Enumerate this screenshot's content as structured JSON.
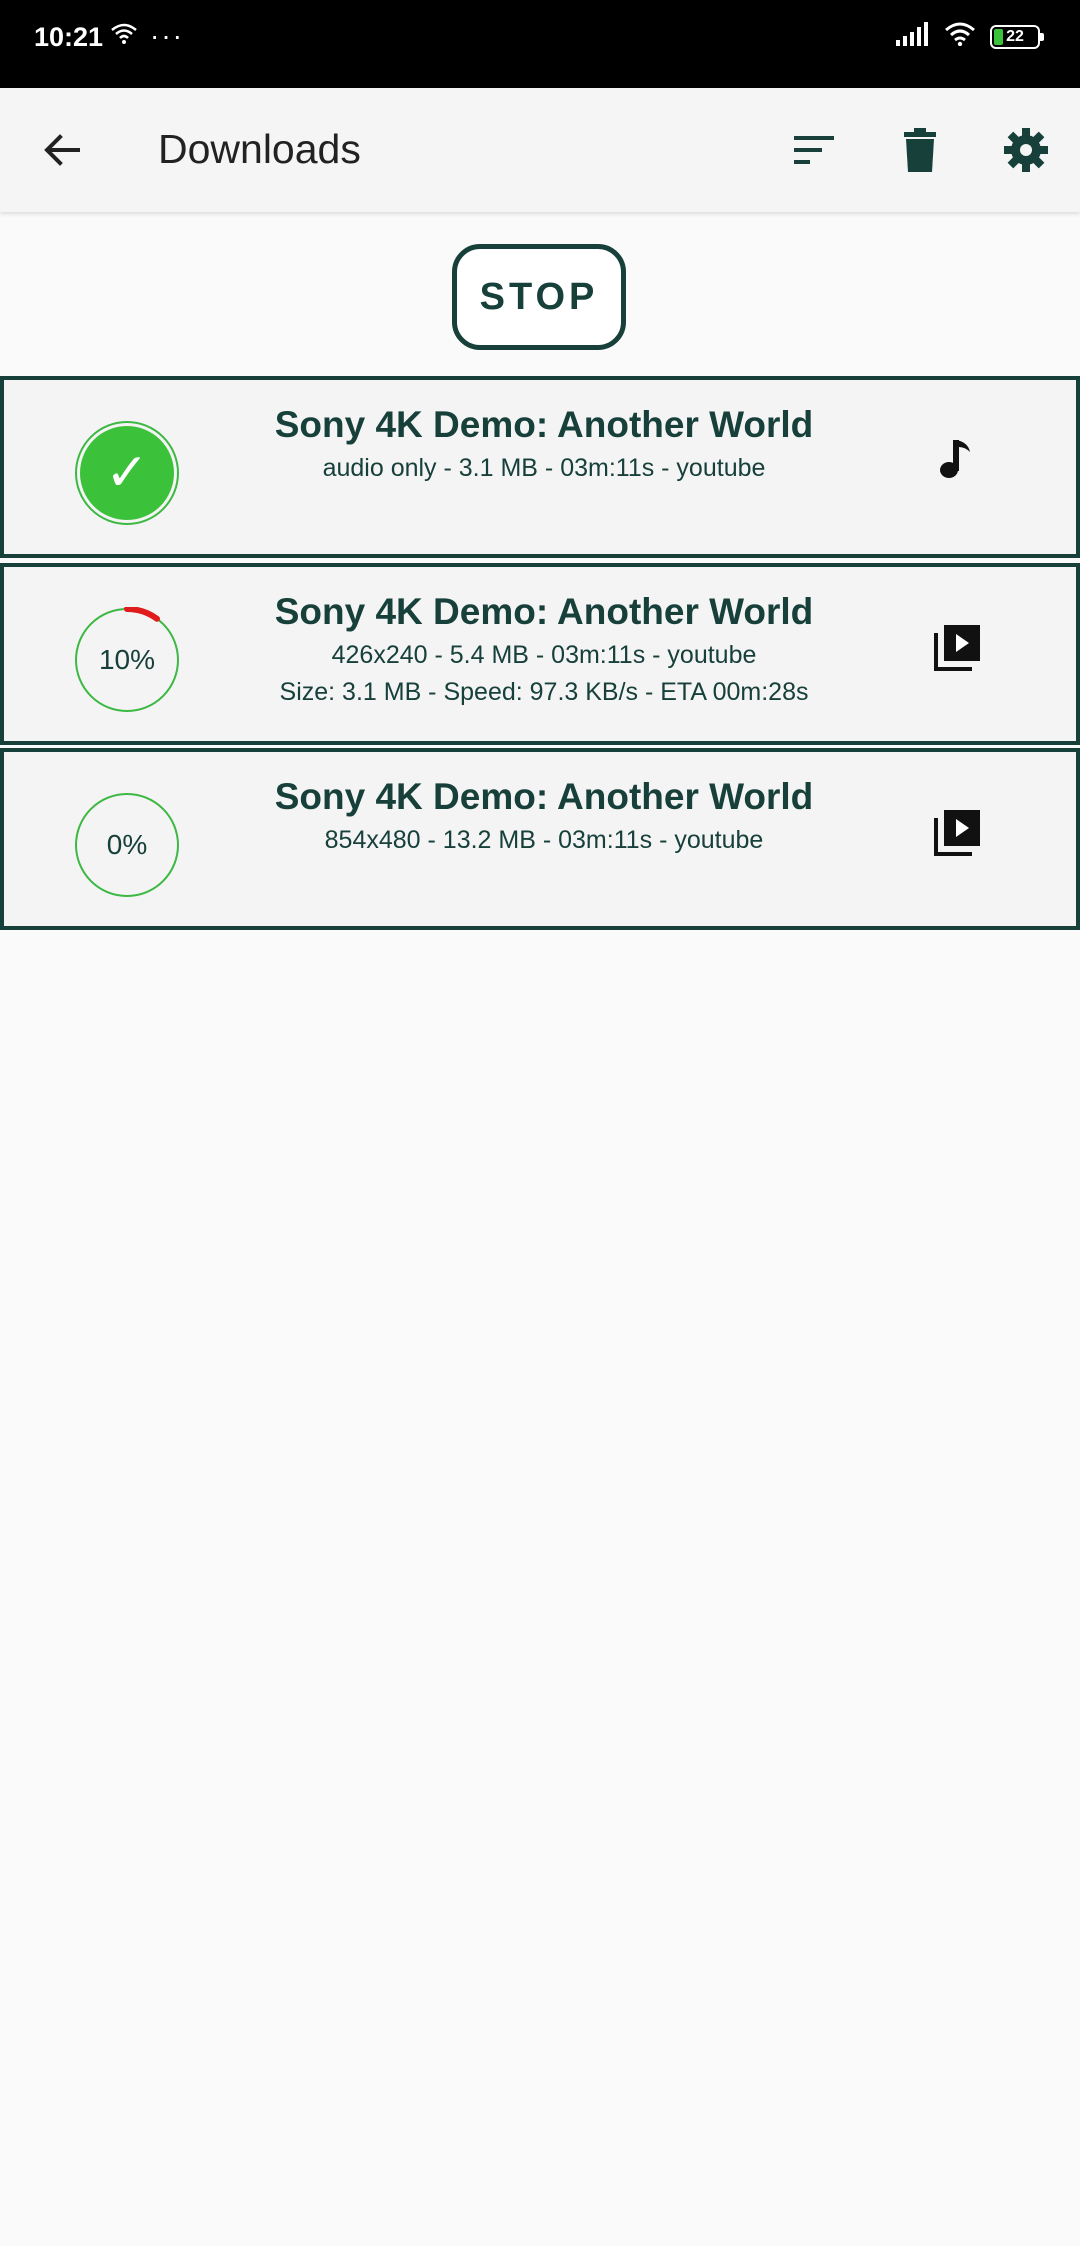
{
  "status_bar": {
    "time": "10:21",
    "dots": "···",
    "battery": "22",
    "battery_level_percent": 22
  },
  "app_bar": {
    "title": "Downloads",
    "back_icon": "arrow-left-icon",
    "actions": [
      "sort-icon",
      "delete-icon",
      "settings-icon"
    ]
  },
  "stop_button": {
    "label": "STOP"
  },
  "downloads": [
    {
      "title": "Sony 4K Demo: Another World",
      "details": "audio only - 3.1 MB - 03m:11s - youtube",
      "status": "complete",
      "type_icon": "music-note-icon",
      "progress_percent": 100
    },
    {
      "title": "Sony 4K Demo: Another World",
      "details": "426x240 - 5.4 MB - 03m:11s - youtube",
      "stats": "Size: 3.1 MB - Speed: 97.3 KB/s - ETA 00m:28s",
      "progress_label": "10%",
      "progress_percent": 10,
      "type_icon": "video-library-icon"
    },
    {
      "title": "Sony 4K Demo: Another World",
      "details": "854x480 - 13.2 MB - 03m:11s - youtube",
      "progress_label": "0%",
      "progress_percent": 0,
      "type_icon": "video-library-icon"
    }
  ],
  "colors": {
    "accent": "#17403b",
    "complete_green": "#3cc13b",
    "progress_red": "#e01b1b",
    "ring_green": "#3cb843"
  }
}
